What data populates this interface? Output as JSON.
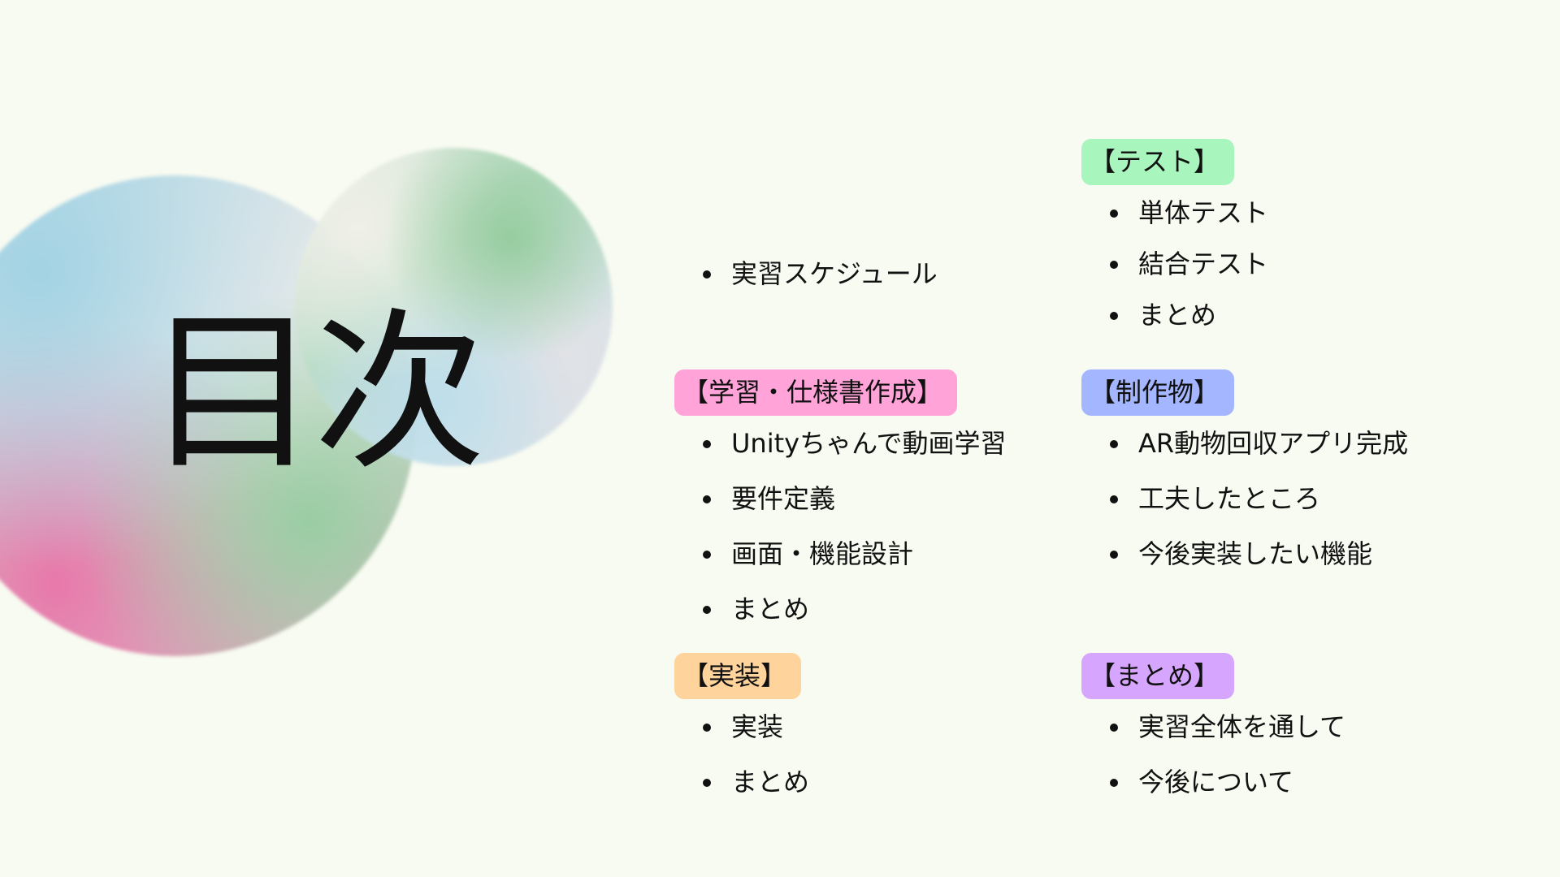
{
  "title": "目次",
  "colors": {
    "background": "#f8fbf2",
    "tag_gakushu": "#ffa3d8",
    "tag_jisso": "#ffd49c",
    "tag_test": "#a8f5bd",
    "tag_seisakubutsu": "#a3b6ff",
    "tag_matome": "#d6a6ff"
  },
  "intro": {
    "items": [
      "実習スケジュール"
    ]
  },
  "gakushu": {
    "label": "【学習・仕様書作成】",
    "items": [
      "Unityちゃんで動画学習",
      "要件定義",
      "画面・機能設計",
      "まとめ"
    ]
  },
  "jisso": {
    "label": "【実装】",
    "items": [
      "実装",
      "まとめ"
    ]
  },
  "test": {
    "label": "【テスト】",
    "items": [
      "単体テスト",
      "結合テスト",
      "まとめ"
    ]
  },
  "seisakubutsu": {
    "label": "【制作物】",
    "items": [
      "AR動物回収アプリ完成",
      "工夫したところ",
      "今後実装したい機能"
    ]
  },
  "matome": {
    "label": "【まとめ】",
    "items": [
      "実習全体を通して",
      "今後について"
    ]
  }
}
